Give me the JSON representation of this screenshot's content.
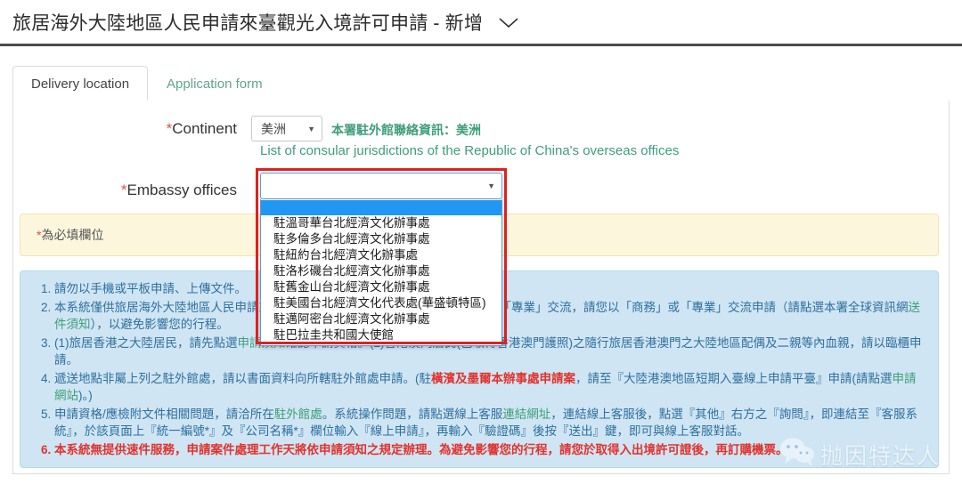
{
  "header": {
    "title": "旅居海外大陸地區人民申請來臺觀光入境許可申請 - 新增",
    "chevron_icon": "chevron-down-icon"
  },
  "tabs": [
    {
      "label": "Delivery location",
      "active": true
    },
    {
      "label": "Application form",
      "active": false
    }
  ],
  "form": {
    "continent": {
      "label_required_mark": "*",
      "label": "Continent",
      "value": "美洲",
      "caret_icon": "caret-down-icon",
      "note": "本署駐外館聯絡資訊：美洲",
      "link": "List of consular jurisdictions of the Republic of China's overseas offices"
    },
    "embassy": {
      "label_required_mark": "*",
      "label": "Embassy offices",
      "value": "",
      "caret_icon": "caret-down-icon",
      "expanded": true,
      "options": [
        "",
        "駐溫哥華台北經濟文化辦事處",
        "駐多倫多台北經濟文化辦事處",
        "駐紐約台北經濟文化辦事處",
        "駐洛杉磯台北經濟文化辦事處",
        "駐舊金山台北經濟文化辦事處",
        "駐美國台北經濟文化代表處(華盛頓特區)",
        "駐邁阿密台北經濟文化辦事處",
        "駐巴拉圭共和國大使館"
      ],
      "selected_index": 0
    }
  },
  "required_banner": {
    "mark": "*",
    "text": "為必填欄位"
  },
  "notes": [
    {
      "id": "note-1",
      "red": false,
      "segments": [
        {
          "t": "請勿以手機或平板申請、上傳文件。",
          "style": "plain"
        }
      ]
    },
    {
      "id": "note-2",
      "red": false,
      "segments": [
        {
          "t": "本系統僅供旅居海外大陸地區人民申請來臺觀光使用，如您來臺目的屬於「商務」或「專業」交流，請您以「商務」或「專業」交流申請（請點選本署全球資訊網",
          "style": "plain"
        },
        {
          "t": "送件須知",
          "style": "link"
        },
        {
          "t": "），以避免影響您的行程。",
          "style": "plain"
        }
      ]
    },
    {
      "id": "note-3",
      "red": false,
      "segments": [
        {
          "t": "(1)旅居香港之大陸居民，請先點選",
          "style": "plain"
        },
        {
          "t": "申請須知",
          "style": "link"
        },
        {
          "t": "確認申請資格。(2)香港澳門居民(已取得香港澳門護照)之隨行旅居香港澳門之大陸地區配偶及二親等內血親，請以臨櫃申請。",
          "style": "plain"
        }
      ]
    },
    {
      "id": "note-4",
      "red": false,
      "segments": [
        {
          "t": "遞送地點非屬上列之駐外館處，請以書面資料向所轄駐外館處申請。(駐",
          "style": "plain"
        },
        {
          "t": "橫濱及墨爾本辦事處申請案",
          "style": "red"
        },
        {
          "t": "，請至『大陸港澳地區短期入臺線上申請平臺』申請(請點選",
          "style": "plain"
        },
        {
          "t": "申請網站",
          "style": "link"
        },
        {
          "t": ")。)",
          "style": "plain"
        }
      ]
    },
    {
      "id": "note-5",
      "red": false,
      "segments": [
        {
          "t": "申請資格/應檢附文件相關問題，請洽所在",
          "style": "plain"
        },
        {
          "t": "駐外館處",
          "style": "link"
        },
        {
          "t": "。系統操作問題，請點選線上客服",
          "style": "plain"
        },
        {
          "t": "連結網址",
          "style": "link"
        },
        {
          "t": "，連結線上客服後，點選『其他』右方之『詢問』，即連結至『客服系統』，於該頁面上『統一編號*』及『公司名稱*』欄位輸入『線上申請』，再輸入『驗證碼』後按『送出』鍵，即可與線上客服對話。",
          "style": "plain"
        }
      ]
    },
    {
      "id": "note-6",
      "red": true,
      "segments": [
        {
          "t": "本系統無提供速件服務，申請案件處理工作天將依申請須知之規定辦理。為避免影響您的行程，請您於取得入出境許可證後，再訂購機票。",
          "style": "plain"
        }
      ]
    }
  ],
  "watermark": {
    "icon": "wechat-icon",
    "text": "抛因特达人"
  },
  "colors": {
    "accent_green": "#3f9e7a",
    "highlight_red": "#e02020",
    "notes_blue_bg": "#cfe5f3",
    "banner_yellow_bg": "#fcf6dd",
    "option_selected_blue": "#2196f3"
  }
}
